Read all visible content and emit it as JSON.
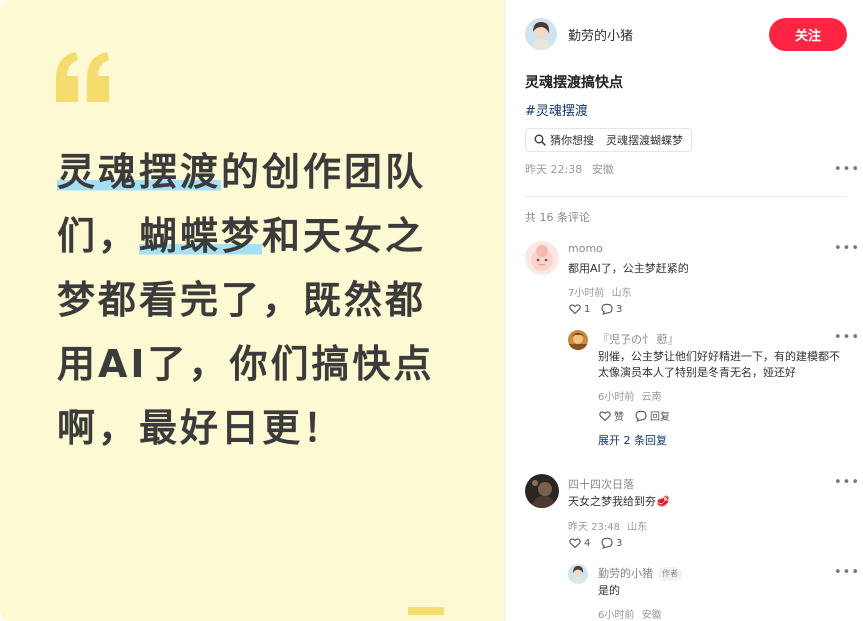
{
  "poster": {
    "segments": [
      {
        "text": "灵魂摆渡",
        "highlight": true
      },
      {
        "text": "的创作团队们，",
        "highlight": false
      },
      {
        "text": "蝴蝶梦",
        "highlight": true
      },
      {
        "text": "和天女之梦都看完了，既然都用AI了，你们搞快点啊，最好日更！",
        "highlight": false
      }
    ],
    "colors": {
      "background": "#fdf9d2",
      "quote": "#f4dc6e",
      "highlight": "#a6e0f6",
      "text": "#3b3b3b"
    }
  },
  "note": {
    "author": "勤劳的小猪",
    "follow_label": "关注",
    "title": "灵魂摆渡搞快点",
    "tag": "#灵魂摆渡",
    "search": {
      "icon": "search-icon",
      "prefix": "猜你想搜",
      "suggestion": "灵魂摆渡蝴蝶梦"
    },
    "date": "昨天 22:38",
    "location": "安徽",
    "more_icon": "more-dots-icon",
    "accent": "#ff2442"
  },
  "comments": {
    "count_label": "共 16 条评论",
    "items": [
      {
        "user": "momo",
        "text": "都用AI了，公主梦赶紧的",
        "time": "7小时前",
        "location": "山东",
        "likes": "1",
        "replies": "3",
        "sub": [
          {
            "user": "『児孒の忄 藯』",
            "text": "别催，公主梦让他们好好精进一下，有的建模都不太像演员本人了特别是冬青无名，娅还好",
            "time": "6小时前",
            "location": "云南",
            "like_label": "赞",
            "reply_label": "回复"
          }
        ],
        "expand_label": "展开 2 条回复"
      },
      {
        "user": "四十四次日落",
        "text": "天女之梦我给到夯🥩",
        "time": "昨天 23:48",
        "location": "山东",
        "likes": "4",
        "replies": "3",
        "sub": [
          {
            "user": "勤劳的小猪",
            "badge": "作者",
            "text": "是的",
            "time": "6小时前",
            "location": "安徽"
          }
        ]
      }
    ]
  }
}
